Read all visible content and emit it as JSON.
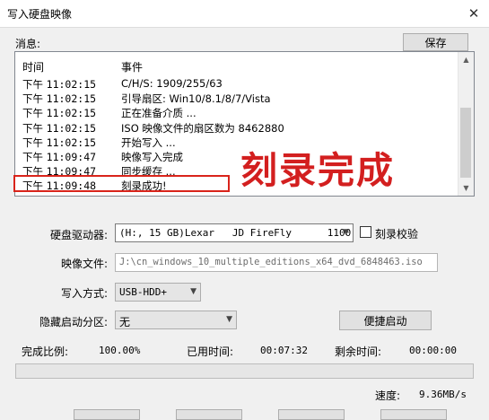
{
  "window": {
    "title": "写入硬盘映像",
    "close_glyph": "✕"
  },
  "messages_label": "消息:",
  "save_button": "保存",
  "log": {
    "columns": [
      "时间",
      "事件"
    ],
    "rows": [
      {
        "ampm": "下午",
        "time": "11:02:15",
        "event": "C/H/S: 1909/255/63"
      },
      {
        "ampm": "下午",
        "time": "11:02:15",
        "event": "引导扇区: Win10/8.1/8/7/Vista"
      },
      {
        "ampm": "下午",
        "time": "11:02:15",
        "event": "正在准备介质 ..."
      },
      {
        "ampm": "下午",
        "time": "11:02:15",
        "event": "ISO 映像文件的扇区数为 8462880"
      },
      {
        "ampm": "下午",
        "time": "11:02:15",
        "event": "开始写入 ..."
      },
      {
        "ampm": "下午",
        "time": "11:09:47",
        "event": "映像写入完成"
      },
      {
        "ampm": "下午",
        "time": "11:09:47",
        "event": "同步缓存 ..."
      },
      {
        "ampm": "下午",
        "time": "11:09:48",
        "event": "刻录成功!"
      }
    ]
  },
  "overlay_text": "刻录完成",
  "drive": {
    "label": "硬盘驱动器:",
    "value": "(H:, 15 GB)Lexar   JD FireFly      1100"
  },
  "verify": {
    "label": "刻录校验",
    "checked": false
  },
  "image_file": {
    "label": "映像文件:",
    "value": "J:\\cn_windows_10_multiple_editions_x64_dvd_6848463.iso"
  },
  "write_mode": {
    "label": "写入方式:",
    "value": "USB-HDD+"
  },
  "hidden_partition": {
    "label": "隐藏启动分区:",
    "value": "无"
  },
  "quick_boot_button": "便捷启动",
  "stats": {
    "complete_label": "完成比例:",
    "complete_value": "100.00%",
    "elapsed_label": "已用时间:",
    "elapsed_value": "00:07:32",
    "remaining_label": "剩余时间:",
    "remaining_value": "00:00:00",
    "speed_label": "速度:",
    "speed_value": "9.36MB/s"
  },
  "progress": {
    "percent": 100
  },
  "colors": {
    "highlight": "#d9241b",
    "overlay": "#d31f1f"
  }
}
